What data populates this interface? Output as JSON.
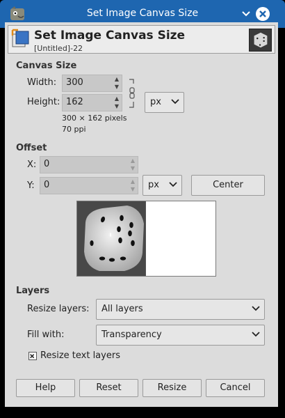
{
  "window": {
    "title": "Set Image Canvas Size"
  },
  "header": {
    "title": "Set Image Canvas Size",
    "subtitle": "[Untitled]-22"
  },
  "canvas_size": {
    "section_title": "Canvas Size",
    "width_label": "Width:",
    "width_value": "300",
    "height_label": "Height:",
    "height_value": "162",
    "unit": "px",
    "pixels_info": "300 × 162 pixels",
    "ppi_info": "70 ppi"
  },
  "offset": {
    "section_title": "Offset",
    "x_label": "X:",
    "x_value": "0",
    "y_label": "Y:",
    "y_value": "0",
    "unit": "px",
    "center_label": "Center"
  },
  "layers": {
    "section_title": "Layers",
    "resize_layers_label": "Resize layers:",
    "resize_layers_value": "All layers",
    "fill_with_label": "Fill with:",
    "fill_with_value": "Transparency",
    "resize_text_layers_label": "Resize text layers",
    "resize_text_layers_checked": true
  },
  "buttons": {
    "help": "Help",
    "reset": "Reset",
    "resize": "Resize",
    "cancel": "Cancel"
  },
  "colors": {
    "titlebar": "#1e66b0",
    "dialog_bg": "#dcdcdc",
    "field_bg": "#c8c8c8"
  }
}
